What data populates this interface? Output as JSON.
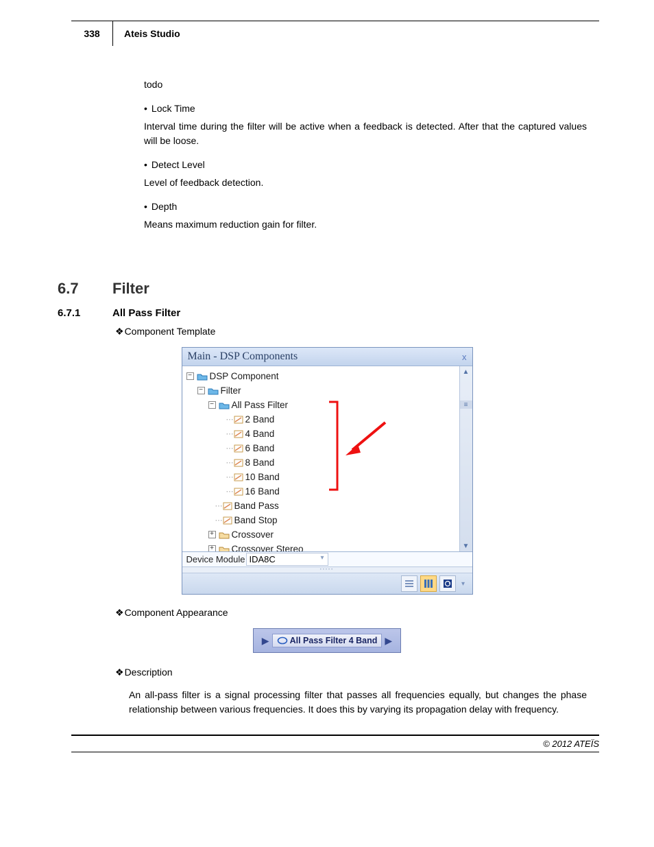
{
  "header": {
    "page_number": "338",
    "title": "Ateis Studio"
  },
  "body": {
    "todo": "todo",
    "items": [
      {
        "label": "Lock Time",
        "desc": "Interval time during the filter will be active when a feedback is detected. After that the captured values will be loose."
      },
      {
        "label": "Detect Level",
        "desc": "Level of feedback detection."
      },
      {
        "label": "Depth",
        "desc": "Means maximum reduction gain for filter."
      }
    ]
  },
  "section": {
    "number": "6.7",
    "title": "Filter"
  },
  "subsection": {
    "number": "6.7.1",
    "title": "All Pass Filter"
  },
  "labels": {
    "component_template": "Component Template",
    "component_appearance": "Component Appearance",
    "description": "Description"
  },
  "panel": {
    "title": "Main - DSP Components",
    "tree": {
      "root": "DSP Component",
      "filter": "Filter",
      "allpass": "All Pass Filter",
      "bands": [
        "2 Band",
        "4 Band",
        "6 Band",
        "8 Band",
        "10 Band",
        "16 Band"
      ],
      "bandpass": "Band Pass",
      "bandstop": "Band Stop",
      "crossover": "Crossover",
      "crossover_stereo": "Crossover Stereo"
    },
    "module_label": "Device Module",
    "module_value": "IDA8C"
  },
  "appearance": {
    "label": "All Pass Filter 4 Band"
  },
  "description_text": "An all-pass filter is a signal processing filter that passes all frequencies equally, but changes the phase relationship between various frequencies. It does this by varying its propagation delay with frequency.",
  "footer": "© 2012 ATEÏS"
}
